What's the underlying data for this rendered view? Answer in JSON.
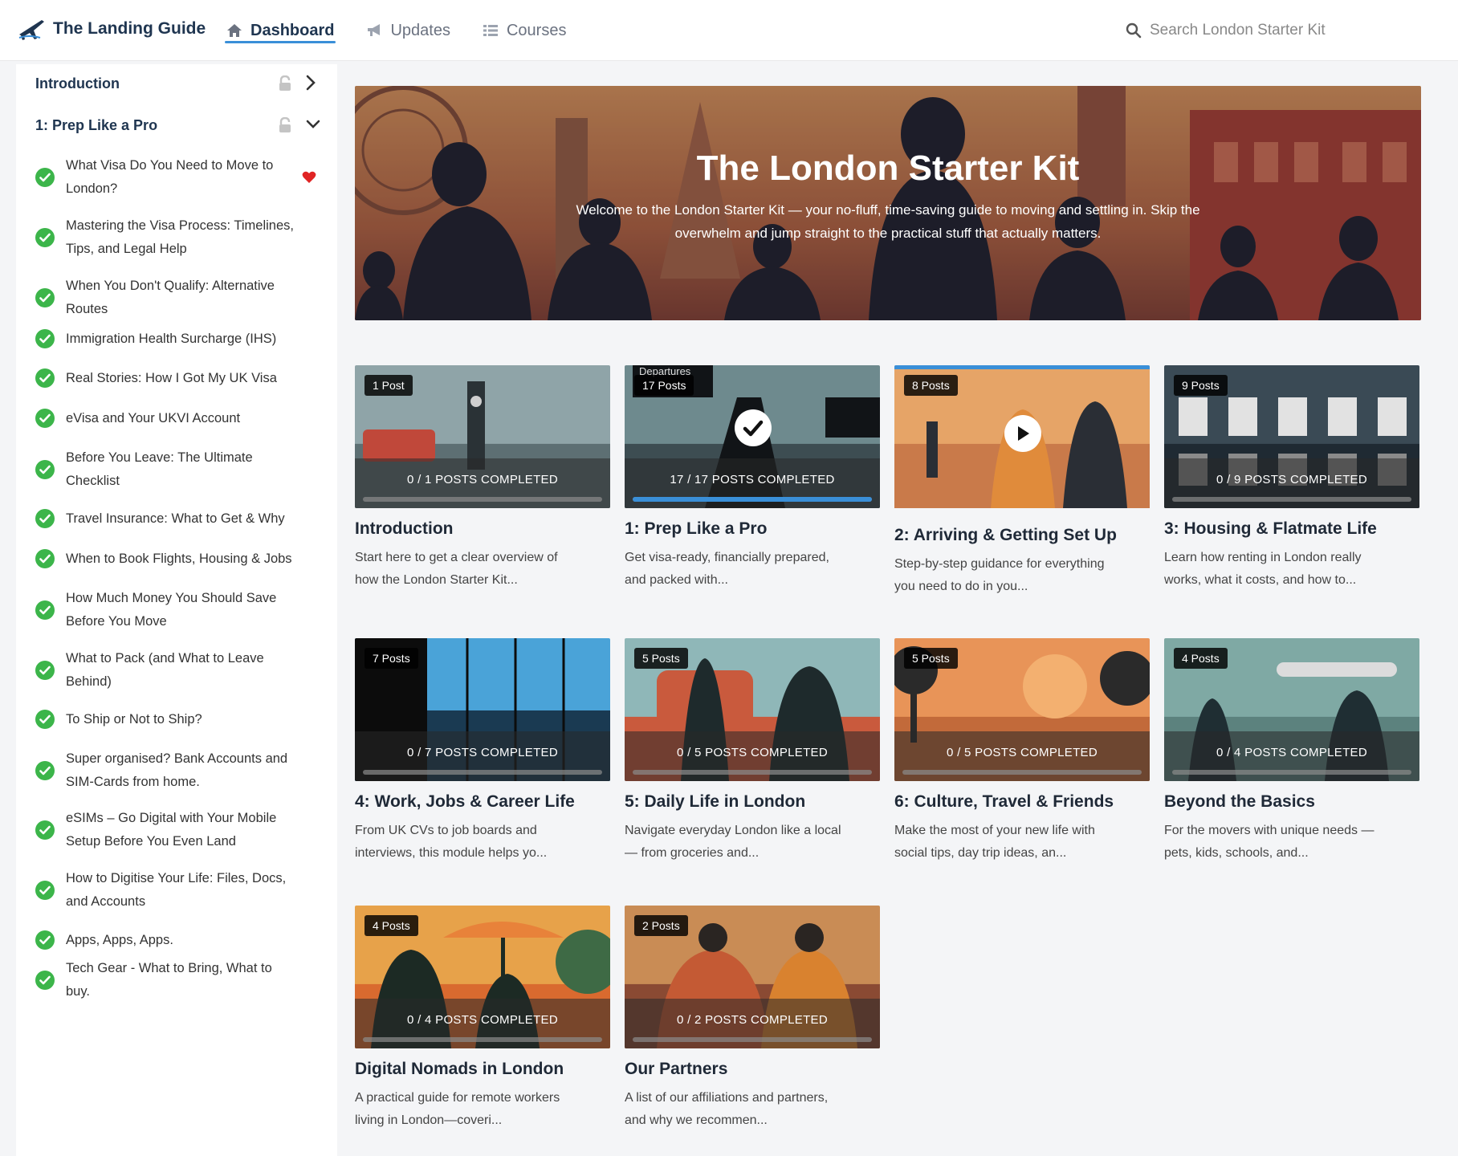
{
  "brand": {
    "name": "The Landing Guide"
  },
  "nav": [
    {
      "label": "Dashboard",
      "icon": "home-icon",
      "active": true
    },
    {
      "label": "Updates",
      "icon": "megaphone-icon",
      "active": false
    },
    {
      "label": "Courses",
      "icon": "list-icon",
      "active": false
    }
  ],
  "search": {
    "placeholder": "Search London Starter Kit"
  },
  "sidebar": {
    "sections": [
      {
        "label": "Introduction",
        "state": "collapsed"
      },
      {
        "label": "1: Prep Like a Pro",
        "state": "expanded"
      }
    ],
    "items": [
      {
        "label": "What Visa Do You Need to Move to London?",
        "favorite": true
      },
      {
        "label": "Mastering the Visa Process: Timelines, Tips, and Legal Help"
      },
      {
        "label": "When You Don't Qualify: Alternative Routes"
      },
      {
        "label": "Immigration Health Surcharge (IHS)"
      },
      {
        "label": "Real Stories: How I Got My UK Visa"
      },
      {
        "label": "eVisa and Your UKVI Account"
      },
      {
        "label": "Before You Leave: The Ultimate Checklist"
      },
      {
        "label": "Travel Insurance: What to Get & Why"
      },
      {
        "label": "When to Book Flights, Housing & Jobs"
      },
      {
        "label": "How Much Money You Should Save Before You Move"
      },
      {
        "label": "What to Pack (and What to Leave Behind)"
      },
      {
        "label": "To Ship or Not to Ship?"
      },
      {
        "label": "Super organised? Bank Accounts and SIM-Cards from home."
      },
      {
        "label": "eSIMs – Go Digital with Your Mobile Setup Before You Even Land"
      },
      {
        "label": "How to Digitise Your Life: Files, Docs, and Accounts"
      },
      {
        "label": "Apps, Apps, Apps."
      },
      {
        "label": "Tech Gear - What to Bring, What to buy."
      }
    ]
  },
  "hero": {
    "title": "The London Starter Kit",
    "subtitle": "Welcome to the London Starter Kit — your no-fluff, time-saving guide to moving and settling in. Skip the overwhelm and jump straight to the practical stuff that actually matters."
  },
  "courses": [
    {
      "badge": "1 Post",
      "progress": "0 / 1 POSTS COMPLETED",
      "completed": 0,
      "total": 1,
      "title": "Introduction",
      "desc": "Start here to get a clear overview of how the London Starter Kit...",
      "overlay": "",
      "scene": "city"
    },
    {
      "badge": "17 Posts",
      "progress": "17 / 17 POSTS COMPLETED",
      "completed": 17,
      "total": 17,
      "title": "1: Prep Like a Pro",
      "desc": "Get visa-ready, financially prepared, and packed with...",
      "overlay": "check-icon",
      "scene": "departures",
      "scene_text": "Departures"
    },
    {
      "badge": "8 Posts",
      "progress": "",
      "completed": 0,
      "total": 8,
      "title": "2: Arriving & Getting Set Up",
      "desc": "Step-by-step guidance for everything you need to do in you...",
      "overlay": "play-icon",
      "scene": "arrival"
    },
    {
      "badge": "9 Posts",
      "progress": "0 / 9 POSTS COMPLETED",
      "completed": 0,
      "total": 9,
      "title": "3: Housing & Flatmate Life",
      "desc": "Learn how renting in London really works, what it costs, and how to...",
      "overlay": "",
      "scene": "housing"
    },
    {
      "badge": "7 Posts",
      "progress": "0 / 7 POSTS COMPLETED",
      "completed": 0,
      "total": 7,
      "title": "4: Work, Jobs & Career Life",
      "desc": "From UK CVs to job boards and interviews, this module helps yo...",
      "overlay": "",
      "scene": "office"
    },
    {
      "badge": "5 Posts",
      "progress": "0 / 5 POSTS COMPLETED",
      "completed": 0,
      "total": 5,
      "title": "5: Daily Life in London",
      "desc": "Navigate everyday London like a local — from groceries and...",
      "overlay": "",
      "scene": "bus"
    },
    {
      "badge": "5 Posts",
      "progress": "0 / 5 POSTS COMPLETED",
      "completed": 0,
      "total": 5,
      "title": "6: Culture, Travel & Friends",
      "desc": "Make the most of your new life with social tips, day trip ideas, an...",
      "overlay": "",
      "scene": "park"
    },
    {
      "badge": "4 Posts",
      "progress": "0 / 4 POSTS COMPLETED",
      "completed": 0,
      "total": 4,
      "title": "Beyond the Basics",
      "desc": "For the movers with unique needs — pets, kids, schools, and...",
      "overlay": "",
      "scene": "airport"
    },
    {
      "badge": "4 Posts",
      "progress": "0 / 4 POSTS COMPLETED",
      "completed": 0,
      "total": 4,
      "title": "Digital Nomads in London",
      "desc": "A practical guide for remote workers living in London—coveri...",
      "overlay": "",
      "scene": "nomad"
    },
    {
      "badge": "2 Posts",
      "progress": "0 / 2 POSTS COMPLETED",
      "completed": 0,
      "total": 2,
      "title": "Our Partners",
      "desc": "A list of our affiliations and partners, and why we recommen...",
      "overlay": "",
      "scene": "partners"
    }
  ],
  "colors": {
    "accent": "#3a8fd8",
    "check": "#3cb54a",
    "heart": "#e02424",
    "brand_text": "#1f3550"
  }
}
